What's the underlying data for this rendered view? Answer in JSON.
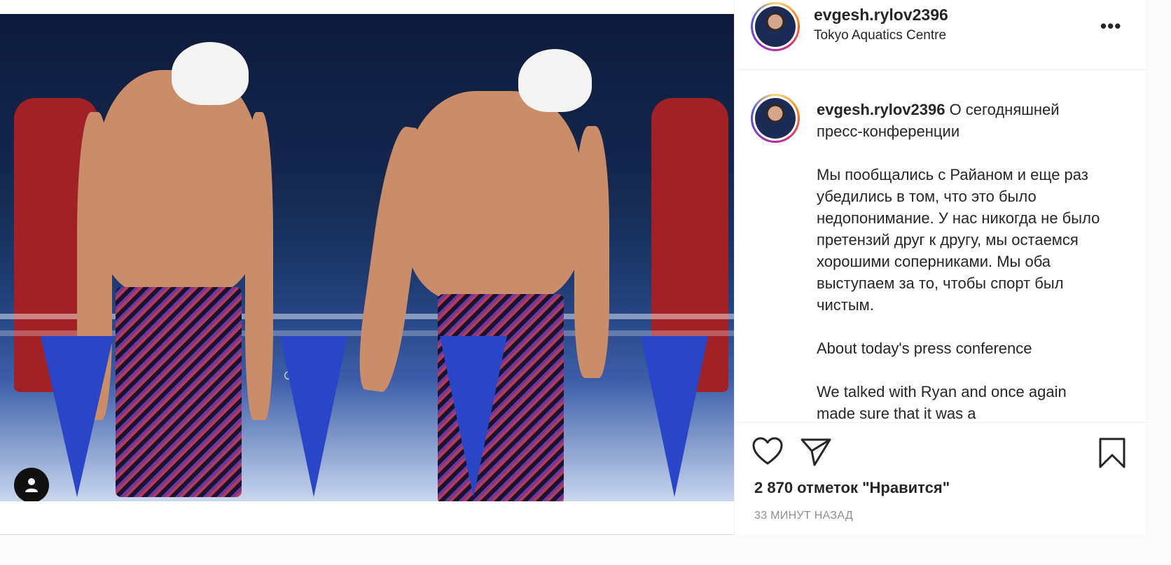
{
  "post": {
    "username": "evgesh.rylov2396",
    "location": "Tokyo Aquatics Centre",
    "more_icon": "ellipsis-icon",
    "caption_author": "evgesh.rylov2396",
    "caption_body": " О сегодняшней пресс-конференции\n\nМы пообщались с Райаном и еще раз убедились в том, что это было недопонимание. У нас никогда не было претензий друг к другу, мы остаемся хорошими соперниками. Мы оба выступаем за то, чтобы спорт был чистым.\n\nAbout today's press conference\n\nWe talked with Ryan and once again made sure that it was a",
    "likes": "2 870 отметок \"Нравится\"",
    "timestamp": "33 МИНУТ НАЗАД",
    "icons": {
      "like": "heart-icon",
      "share": "paper-plane-icon",
      "save": "bookmark-icon",
      "tagged": "user-icon"
    }
  }
}
